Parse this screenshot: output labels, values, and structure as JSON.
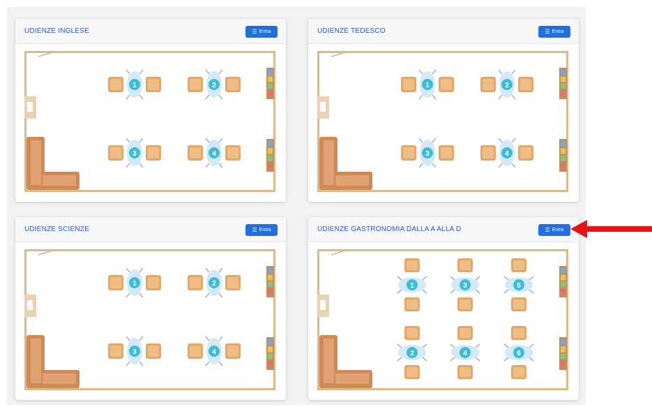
{
  "rooms": [
    {
      "title": "UDIENZE INGLESE",
      "button_label": "Entra",
      "layout": "two-row",
      "tables": [
        "1",
        "2",
        "3",
        "4"
      ]
    },
    {
      "title": "UDIENZE TEDESCO",
      "button_label": "Entra",
      "layout": "two-row",
      "tables": [
        "1",
        "2",
        "3",
        "4"
      ]
    },
    {
      "title": "UDIENZE SCIENZE",
      "button_label": "Entra",
      "layout": "two-row",
      "tables": [
        "1",
        "2",
        "3",
        "4"
      ]
    },
    {
      "title": "UDIENZE GASTRONOMIA DALLA A ALLA D",
      "button_label": "Entra",
      "layout": "three-col",
      "tables": [
        "1",
        "3",
        "5",
        "2",
        "4",
        "6"
      ]
    }
  ],
  "button_icon": "list-icon",
  "annotation": {
    "type": "red-arrow",
    "color": "#e81313",
    "points_to": "entra-button-room-4"
  },
  "colors": {
    "title": "#2d54c2",
    "button": "#1f6fe0",
    "wall": "#deb887",
    "chair": "#e4a766",
    "sofa": "#cf8a57",
    "table": "#d4e9f7",
    "table_number": "#3bbdd6"
  }
}
